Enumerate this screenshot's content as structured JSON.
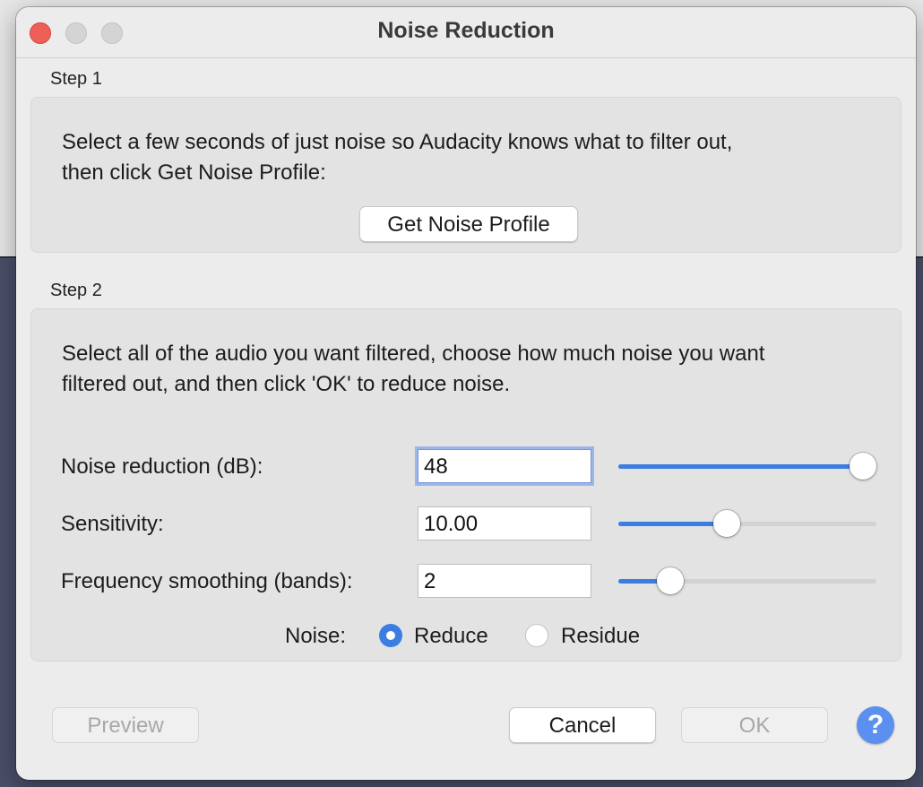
{
  "window": {
    "title": "Noise Reduction"
  },
  "step1": {
    "label": "Step 1",
    "text_line1": "Select a few seconds of just noise so Audacity knows what to filter out,",
    "text_line2": "then click Get Noise Profile:",
    "button": "Get Noise Profile"
  },
  "step2": {
    "label": "Step 2",
    "text_line1": "Select all of the audio you want filtered, choose how much noise you want",
    "text_line2": "filtered out, and then click 'OK' to reduce noise.",
    "fields": [
      {
        "label": "Noise reduction (dB):",
        "value": "48",
        "slider_fraction": 0.95
      },
      {
        "label": "Sensitivity:",
        "value": "10.00",
        "slider_fraction": 0.42
      },
      {
        "label": "Frequency smoothing (bands):",
        "value": "2",
        "slider_fraction": 0.2
      }
    ],
    "noise": {
      "label": "Noise:",
      "options": [
        {
          "label": "Reduce",
          "selected": true
        },
        {
          "label": "Residue",
          "selected": false
        }
      ]
    }
  },
  "buttons": {
    "preview": "Preview",
    "cancel": "Cancel",
    "ok": "OK",
    "help": "?"
  },
  "colors": {
    "accent": "#3b7de0",
    "close": "#ee5f57"
  }
}
